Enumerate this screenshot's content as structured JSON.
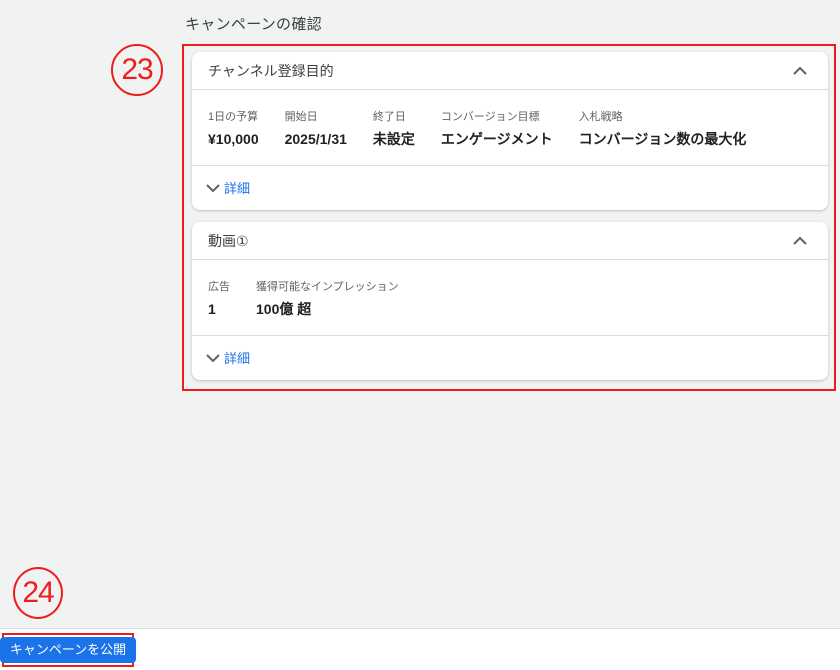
{
  "page": {
    "title": "キャンペーンの確認",
    "background_color": "#f1f2f2"
  },
  "annotations": {
    "step23": {
      "label": "23"
    },
    "step24": {
      "label": "24"
    },
    "color": "#ee1c1c"
  },
  "cards": [
    {
      "title": "チャンネル登録目的",
      "collapse_icon": "chevron-up-icon",
      "fields": [
        {
          "label": "1日の予算",
          "value": "¥10,000"
        },
        {
          "label": "開始日",
          "value": "2025/1/31"
        },
        {
          "label": "終了日",
          "value": "未設定"
        },
        {
          "label": "コンバージョン目標",
          "value": "エンゲージメント"
        },
        {
          "label": "入札戦略",
          "value": "コンバージョン数の最大化"
        }
      ],
      "details_label": "詳細",
      "details_icon": "chevron-down-icon"
    },
    {
      "title": "動画①",
      "collapse_icon": "chevron-up-icon",
      "fields": [
        {
          "label": "広告",
          "value": "1"
        },
        {
          "label": "獲得可能なインプレッション",
          "value": "100億 超"
        }
      ],
      "details_label": "詳細",
      "details_icon": "chevron-down-icon"
    }
  ],
  "footer": {
    "publish_button_label": "キャンペーンを公開"
  },
  "colors": {
    "accent_blue": "#1a73e8",
    "annotation_red": "#ee1c1c",
    "divider": "#dadce0",
    "label_gray": "#5f6368",
    "text_dark": "#202124"
  }
}
